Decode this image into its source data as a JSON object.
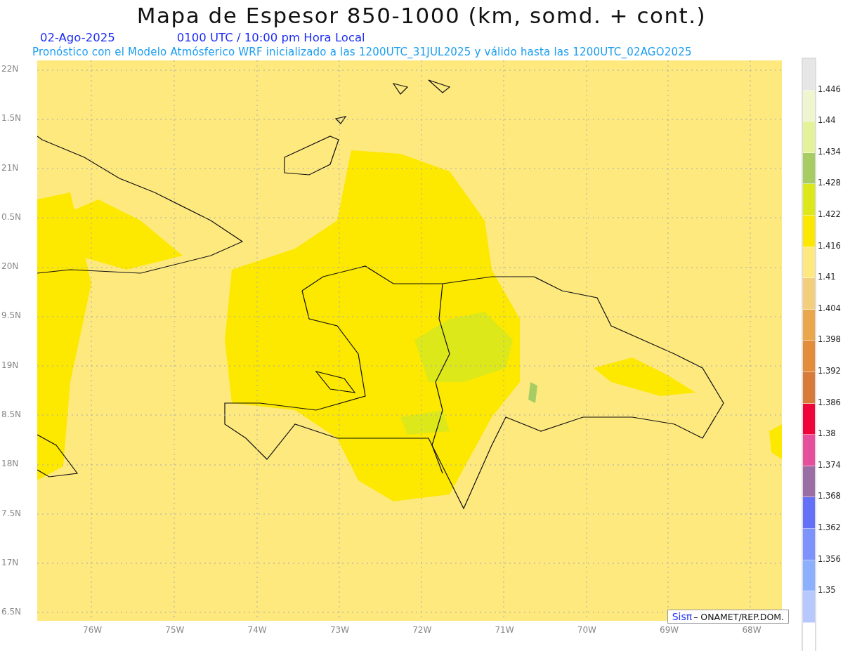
{
  "title": "Mapa de Espesor 850-1000 (km, somd. + cont.)",
  "date": "02-Ago-2025",
  "time": "0100 UTC / 10:00 pm Hora Local",
  "subtitle": "Pronóstico con el Modelo Atmósferico WRF inicializado a las 1200UTC_31JUL2025 y válido hasta las  1200UTC_02AGO2025",
  "lat_labels": [
    "22N",
    "1.5N",
    "21N",
    "0.5N",
    "20N",
    "9.5N",
    "19N",
    "8.5N",
    "18N",
    "7.5N",
    "17N",
    "6.5N"
  ],
  "lon_labels": [
    "76W",
    "75W",
    "74W",
    "73W",
    "72W",
    "71W",
    "70W",
    "69W",
    "68W"
  ],
  "credit": {
    "logo": "Sisπ",
    "text": "– ONAMET/REP.DOM."
  },
  "colorbar": {
    "segments": [
      {
        "color": "#e6e6e6"
      },
      {
        "color": "#eef5cf"
      },
      {
        "color": "#e4f29a"
      },
      {
        "color": "#a8cc64"
      },
      {
        "color": "#dde81a"
      },
      {
        "color": "#fbe700"
      },
      {
        "color": "#fde97f"
      },
      {
        "color": "#f3cf7d"
      },
      {
        "color": "#eaa64a"
      },
      {
        "color": "#e38c3c"
      },
      {
        "color": "#d87a3a"
      },
      {
        "color": "#ef053b"
      },
      {
        "color": "#e64f9c"
      },
      {
        "color": "#9a6ea5"
      },
      {
        "color": "#6470f8"
      },
      {
        "color": "#7d92fc"
      },
      {
        "color": "#8db0fe"
      },
      {
        "color": "#b7c8fe"
      }
    ],
    "labels": [
      "1.446",
      "1.44",
      "1.434",
      "1.428",
      "1.422",
      "1.416",
      "1.41",
      "1.404",
      "1.398",
      "1.392",
      "1.386",
      "1.38",
      "1.374",
      "1.368",
      "1.362",
      "1.356",
      "1.35"
    ]
  }
}
